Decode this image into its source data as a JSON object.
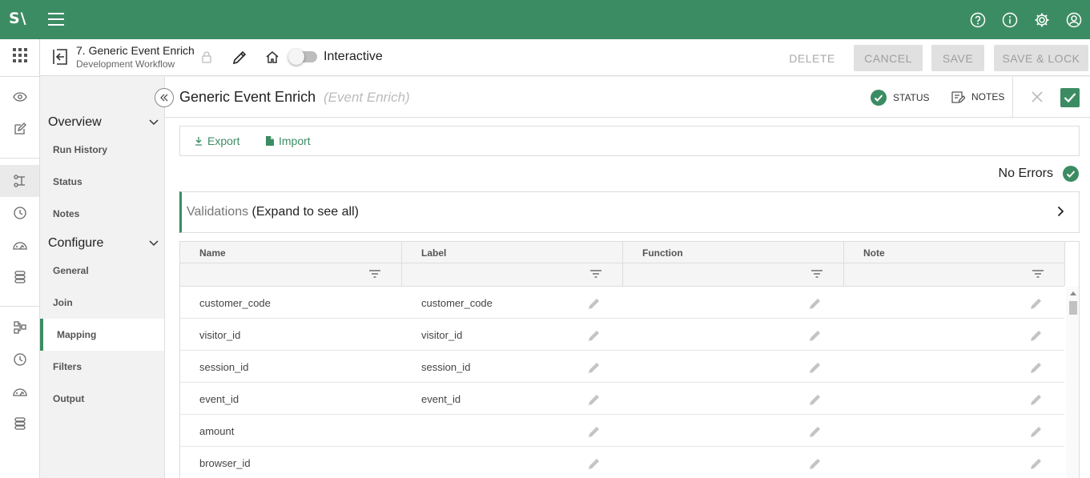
{
  "app": {
    "logo": "S\\",
    "accent_color": "#3c8c63"
  },
  "topbar": {
    "icons": [
      "help-icon",
      "info-icon",
      "settings-icon",
      "account-icon"
    ]
  },
  "header": {
    "workflow_title": "7. Generic Event Enrich",
    "workflow_subtitle": "Development Workflow",
    "toggle_label": "Interactive",
    "buttons": {
      "delete": "DELETE",
      "cancel": "CANCEL",
      "save": "SAVE",
      "save_lock": "SAVE & LOCK"
    }
  },
  "sidenav": {
    "overview": {
      "label": "Overview",
      "items": [
        "Run History",
        "Status",
        "Notes"
      ]
    },
    "configure": {
      "label": "Configure",
      "items": [
        "General",
        "Join",
        "Mapping",
        "Filters",
        "Output"
      ]
    },
    "active_item": "Mapping"
  },
  "component": {
    "title": "Generic Event Enrich",
    "type": "(Event Enrich)",
    "status_label": "STATUS",
    "notes_label": "NOTES"
  },
  "toolbar": {
    "export_label": "Export",
    "import_label": "Import"
  },
  "validation": {
    "no_errors": "No Errors",
    "title": "Validations",
    "hint": "(Expand to see all)"
  },
  "grid": {
    "columns": [
      "Name",
      "Label",
      "Function",
      "Note"
    ],
    "rows": [
      {
        "name": "customer_code",
        "label": "customer_code"
      },
      {
        "name": "visitor_id",
        "label": "visitor_id"
      },
      {
        "name": "session_id",
        "label": "session_id"
      },
      {
        "name": "event_id",
        "label": "event_id"
      },
      {
        "name": "amount",
        "label": ""
      },
      {
        "name": "browser_id",
        "label": ""
      }
    ]
  }
}
